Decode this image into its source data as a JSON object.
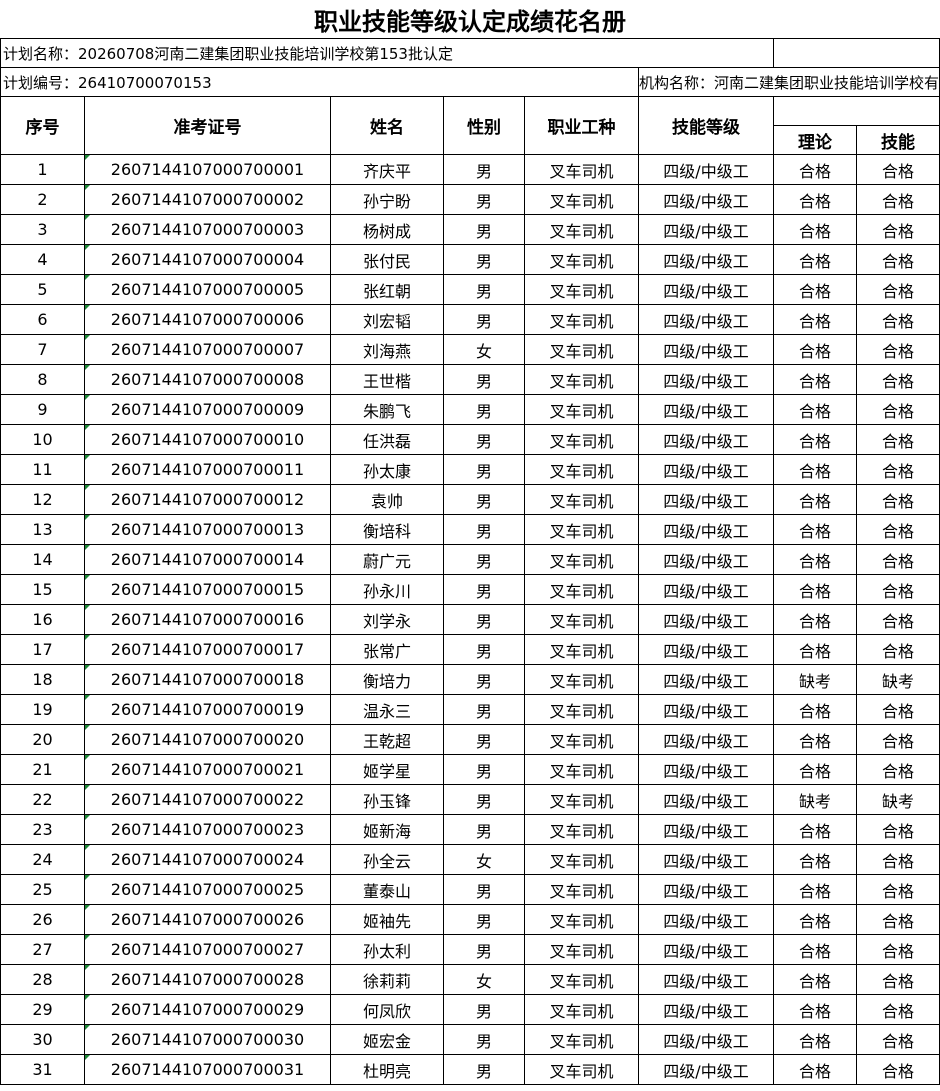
{
  "title": "职业技能等级认定成绩花名册",
  "plan_name": "计划名称：20260708河南二建集团职业技能培训学校第153批认定",
  "plan_number": "计划编号：26410700070153",
  "institution": "机构名称：河南二建集团职业技能培训学校有限公司",
  "headers": {
    "seq": "序号",
    "ticket": "准考证号",
    "name": "姓名",
    "gender": "性别",
    "job": "职业工种",
    "level": "技能等级",
    "theory": "理论",
    "skill": "技能"
  },
  "rows": [
    {
      "seq": "1",
      "ticket": "2607144107000700001",
      "name": "齐庆平",
      "gender": "男",
      "job": "叉车司机",
      "level": "四级/中级工",
      "theory": "合格",
      "skill": "合格"
    },
    {
      "seq": "2",
      "ticket": "2607144107000700002",
      "name": "孙宁盼",
      "gender": "男",
      "job": "叉车司机",
      "level": "四级/中级工",
      "theory": "合格",
      "skill": "合格"
    },
    {
      "seq": "3",
      "ticket": "2607144107000700003",
      "name": "杨树成",
      "gender": "男",
      "job": "叉车司机",
      "level": "四级/中级工",
      "theory": "合格",
      "skill": "合格"
    },
    {
      "seq": "4",
      "ticket": "2607144107000700004",
      "name": "张付民",
      "gender": "男",
      "job": "叉车司机",
      "level": "四级/中级工",
      "theory": "合格",
      "skill": "合格"
    },
    {
      "seq": "5",
      "ticket": "2607144107000700005",
      "name": "张红朝",
      "gender": "男",
      "job": "叉车司机",
      "level": "四级/中级工",
      "theory": "合格",
      "skill": "合格"
    },
    {
      "seq": "6",
      "ticket": "2607144107000700006",
      "name": "刘宏韬",
      "gender": "男",
      "job": "叉车司机",
      "level": "四级/中级工",
      "theory": "合格",
      "skill": "合格"
    },
    {
      "seq": "7",
      "ticket": "2607144107000700007",
      "name": "刘海燕",
      "gender": "女",
      "job": "叉车司机",
      "level": "四级/中级工",
      "theory": "合格",
      "skill": "合格"
    },
    {
      "seq": "8",
      "ticket": "2607144107000700008",
      "name": "王世楷",
      "gender": "男",
      "job": "叉车司机",
      "level": "四级/中级工",
      "theory": "合格",
      "skill": "合格"
    },
    {
      "seq": "9",
      "ticket": "2607144107000700009",
      "name": "朱鹏飞",
      "gender": "男",
      "job": "叉车司机",
      "level": "四级/中级工",
      "theory": "合格",
      "skill": "合格"
    },
    {
      "seq": "10",
      "ticket": "2607144107000700010",
      "name": "任洪磊",
      "gender": "男",
      "job": "叉车司机",
      "level": "四级/中级工",
      "theory": "合格",
      "skill": "合格"
    },
    {
      "seq": "11",
      "ticket": "2607144107000700011",
      "name": "孙太康",
      "gender": "男",
      "job": "叉车司机",
      "level": "四级/中级工",
      "theory": "合格",
      "skill": "合格"
    },
    {
      "seq": "12",
      "ticket": "2607144107000700012",
      "name": "袁帅",
      "gender": "男",
      "job": "叉车司机",
      "level": "四级/中级工",
      "theory": "合格",
      "skill": "合格"
    },
    {
      "seq": "13",
      "ticket": "2607144107000700013",
      "name": "衡培科",
      "gender": "男",
      "job": "叉车司机",
      "level": "四级/中级工",
      "theory": "合格",
      "skill": "合格"
    },
    {
      "seq": "14",
      "ticket": "2607144107000700014",
      "name": "蔚广元",
      "gender": "男",
      "job": "叉车司机",
      "level": "四级/中级工",
      "theory": "合格",
      "skill": "合格"
    },
    {
      "seq": "15",
      "ticket": "2607144107000700015",
      "name": "孙永川",
      "gender": "男",
      "job": "叉车司机",
      "level": "四级/中级工",
      "theory": "合格",
      "skill": "合格"
    },
    {
      "seq": "16",
      "ticket": "2607144107000700016",
      "name": "刘学永",
      "gender": "男",
      "job": "叉车司机",
      "level": "四级/中级工",
      "theory": "合格",
      "skill": "合格"
    },
    {
      "seq": "17",
      "ticket": "2607144107000700017",
      "name": "张常广",
      "gender": "男",
      "job": "叉车司机",
      "level": "四级/中级工",
      "theory": "合格",
      "skill": "合格"
    },
    {
      "seq": "18",
      "ticket": "2607144107000700018",
      "name": "衡培力",
      "gender": "男",
      "job": "叉车司机",
      "level": "四级/中级工",
      "theory": "缺考",
      "skill": "缺考"
    },
    {
      "seq": "19",
      "ticket": "2607144107000700019",
      "name": "温永三",
      "gender": "男",
      "job": "叉车司机",
      "level": "四级/中级工",
      "theory": "合格",
      "skill": "合格"
    },
    {
      "seq": "20",
      "ticket": "2607144107000700020",
      "name": "王乾超",
      "gender": "男",
      "job": "叉车司机",
      "level": "四级/中级工",
      "theory": "合格",
      "skill": "合格"
    },
    {
      "seq": "21",
      "ticket": "2607144107000700021",
      "name": "姬学星",
      "gender": "男",
      "job": "叉车司机",
      "level": "四级/中级工",
      "theory": "合格",
      "skill": "合格"
    },
    {
      "seq": "22",
      "ticket": "2607144107000700022",
      "name": "孙玉锋",
      "gender": "男",
      "job": "叉车司机",
      "level": "四级/中级工",
      "theory": "缺考",
      "skill": "缺考"
    },
    {
      "seq": "23",
      "ticket": "2607144107000700023",
      "name": "姬新海",
      "gender": "男",
      "job": "叉车司机",
      "level": "四级/中级工",
      "theory": "合格",
      "skill": "合格"
    },
    {
      "seq": "24",
      "ticket": "2607144107000700024",
      "name": "孙全云",
      "gender": "女",
      "job": "叉车司机",
      "level": "四级/中级工",
      "theory": "合格",
      "skill": "合格"
    },
    {
      "seq": "25",
      "ticket": "2607144107000700025",
      "name": "董泰山",
      "gender": "男",
      "job": "叉车司机",
      "level": "四级/中级工",
      "theory": "合格",
      "skill": "合格"
    },
    {
      "seq": "26",
      "ticket": "2607144107000700026",
      "name": "姬袖先",
      "gender": "男",
      "job": "叉车司机",
      "level": "四级/中级工",
      "theory": "合格",
      "skill": "合格"
    },
    {
      "seq": "27",
      "ticket": "2607144107000700027",
      "name": "孙太利",
      "gender": "男",
      "job": "叉车司机",
      "level": "四级/中级工",
      "theory": "合格",
      "skill": "合格"
    },
    {
      "seq": "28",
      "ticket": "2607144107000700028",
      "name": "徐莉莉",
      "gender": "女",
      "job": "叉车司机",
      "level": "四级/中级工",
      "theory": "合格",
      "skill": "合格"
    },
    {
      "seq": "29",
      "ticket": "2607144107000700029",
      "name": "何凤欣",
      "gender": "男",
      "job": "叉车司机",
      "level": "四级/中级工",
      "theory": "合格",
      "skill": "合格"
    },
    {
      "seq": "30",
      "ticket": "2607144107000700030",
      "name": "姬宏金",
      "gender": "男",
      "job": "叉车司机",
      "level": "四级/中级工",
      "theory": "合格",
      "skill": "合格"
    },
    {
      "seq": "31",
      "ticket": "2607144107000700031",
      "name": "杜明亮",
      "gender": "男",
      "job": "叉车司机",
      "level": "四级/中级工",
      "theory": "合格",
      "skill": "合格"
    }
  ]
}
